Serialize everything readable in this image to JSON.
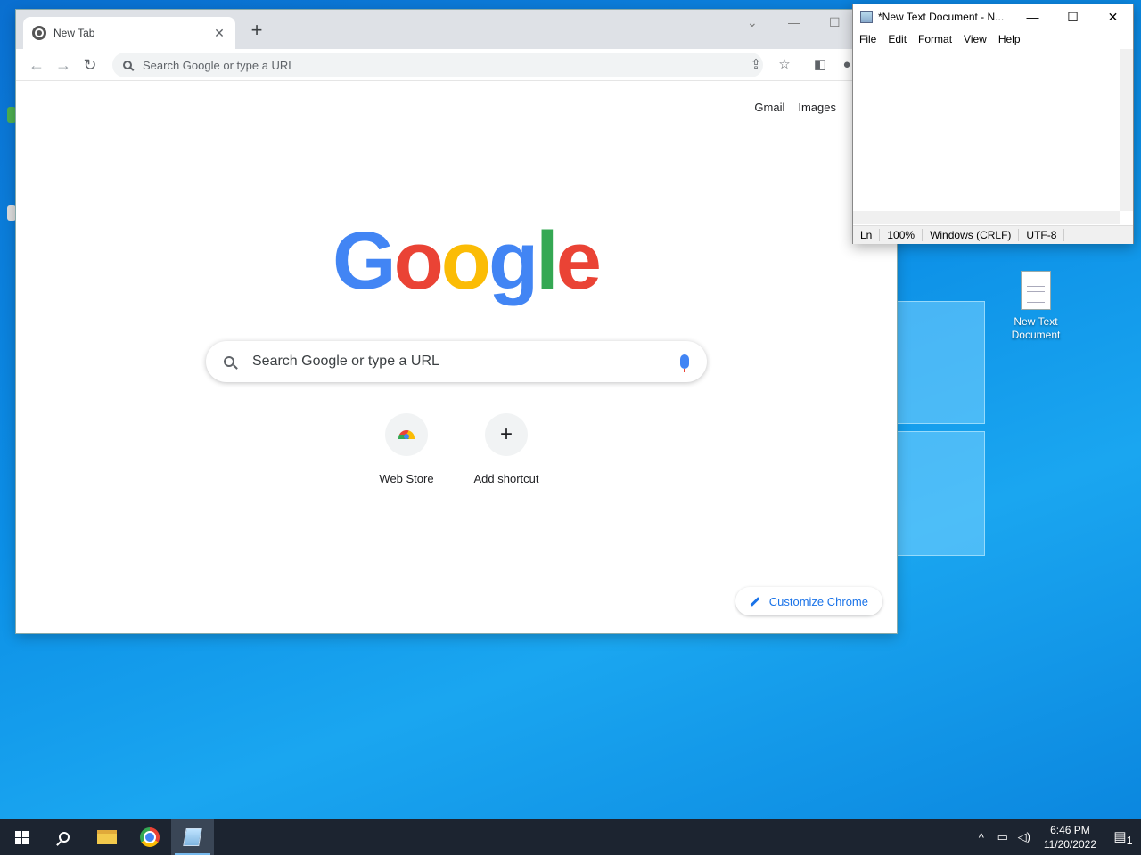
{
  "desktop": {
    "icons": [
      {
        "label": "New Text Document",
        "icon": "text-file-icon"
      }
    ]
  },
  "chrome": {
    "tab_title": "New Tab",
    "omnibox_placeholder": "Search Google or type a URL",
    "top_links": {
      "gmail": "Gmail",
      "images": "Images"
    },
    "logo_text": "Google",
    "search_placeholder": "Search Google or type a URL",
    "shortcuts": [
      {
        "label": "Web Store",
        "icon": "web-store-icon"
      },
      {
        "label": "Add shortcut",
        "icon": "plus-icon",
        "glyph": "+"
      }
    ],
    "customize_label": "Customize Chrome",
    "colors": {
      "blue": "#4285f4",
      "red": "#ea4335",
      "yellow": "#fbbc05",
      "green": "#34a853",
      "accent": "#1a73e8"
    }
  },
  "notepad": {
    "title": "*New Text Document - N...",
    "menu": [
      "File",
      "Edit",
      "Format",
      "View",
      "Help"
    ],
    "content": "",
    "status": {
      "ln": "Ln",
      "zoom": "100%",
      "line_ending": "Windows (CRLF)",
      "encoding": "UTF-8"
    }
  },
  "taskbar": {
    "apps": [
      "start-icon",
      "search-icon",
      "file-explorer-icon",
      "chrome-icon",
      "notepad-icon"
    ],
    "clock_time": "6:46 PM",
    "clock_date": "11/20/2022",
    "notification_count": "1"
  }
}
